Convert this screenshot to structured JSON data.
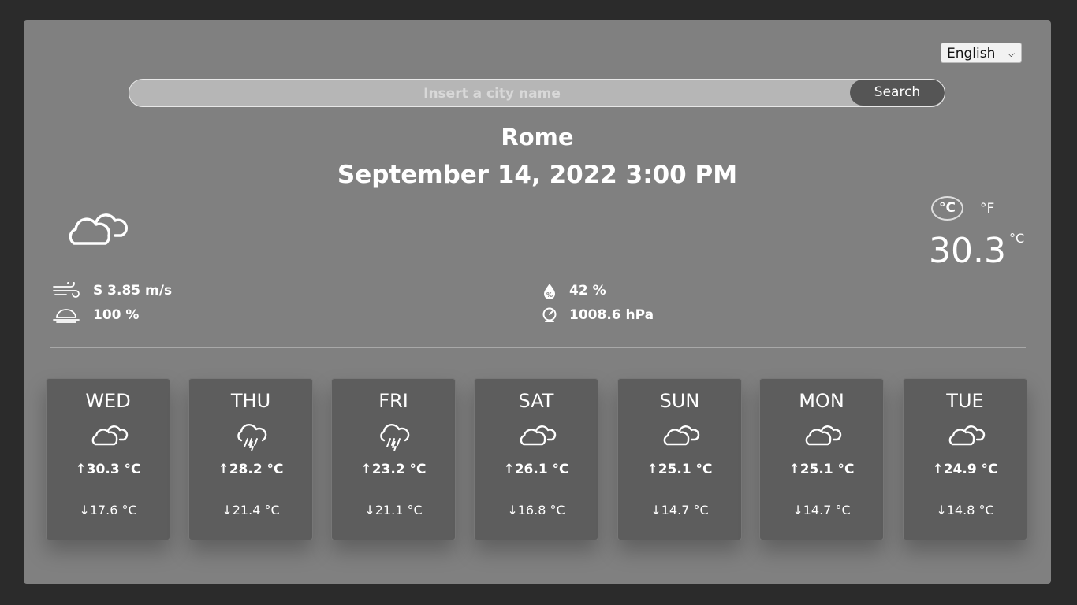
{
  "language": {
    "selected": "English"
  },
  "search": {
    "placeholder": "Insert a city name",
    "button_label": "Search"
  },
  "current": {
    "city": "Rome",
    "datetime": "September 14, 2022 3:00 PM",
    "condition_icon": "cloud-icon",
    "temperature": "30.3",
    "temperature_unit": "°C",
    "unit_celsius": "°C",
    "unit_fahrenheit": "°F",
    "wind": "S 3.85 m/s",
    "cloudiness": "100 %",
    "humidity": "42 %",
    "pressure": "1008.6 hPa"
  },
  "forecast": [
    {
      "day": "WED",
      "icon": "cloud-icon",
      "high": "↑30.3 °C",
      "low": "↓17.6 °C"
    },
    {
      "day": "THU",
      "icon": "storm-icon",
      "high": "↑28.2 °C",
      "low": "↓21.4 °C"
    },
    {
      "day": "FRI",
      "icon": "storm-icon",
      "high": "↑23.2 °C",
      "low": "↓21.1 °C"
    },
    {
      "day": "SAT",
      "icon": "cloud-icon",
      "high": "↑26.1 °C",
      "low": "↓16.8 °C"
    },
    {
      "day": "SUN",
      "icon": "cloud-icon",
      "high": "↑25.1 °C",
      "low": "↓14.7 °C"
    },
    {
      "day": "MON",
      "icon": "cloud-icon",
      "high": "↑25.1 °C",
      "low": "↓14.7 °C"
    },
    {
      "day": "TUE",
      "icon": "cloud-icon",
      "high": "↑24.9 °C",
      "low": "↓14.8 °C"
    }
  ],
  "colors": {
    "page_bg": "#2b2b2b",
    "panel_bg": "#808080",
    "card_bg": "#5d5d5d",
    "button_bg": "#555555"
  }
}
